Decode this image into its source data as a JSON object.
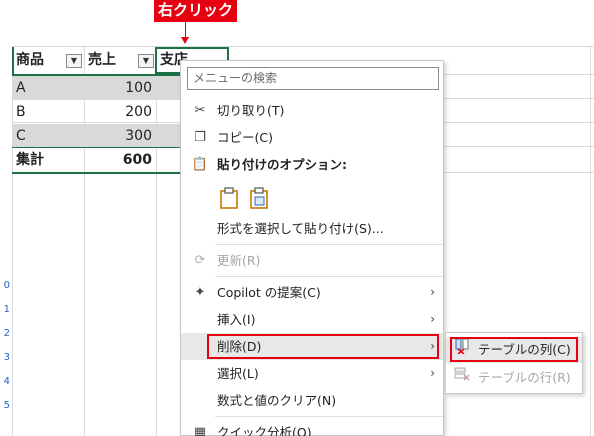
{
  "callout": {
    "text": "右クリック"
  },
  "table": {
    "headers": [
      "商品",
      "売上",
      "支店"
    ],
    "rows": [
      {
        "item": "A",
        "sales": "100"
      },
      {
        "item": "B",
        "sales": "200"
      },
      {
        "item": "C",
        "sales": "300"
      }
    ],
    "total": {
      "label": "集計",
      "value": "600"
    }
  },
  "row_numbers": [
    "0",
    "1",
    "2",
    "3",
    "4",
    "5"
  ],
  "context_menu": {
    "search_placeholder": "メニューの検索",
    "items": {
      "cut": "切り取り(T)",
      "copy": "コピー(C)",
      "paste_options": "貼り付けのオプション:",
      "paste_special": "形式を選択して貼り付け(S)...",
      "refresh": "更新(R)",
      "copilot": "Copilot の提案(C)",
      "insert": "挿入(I)",
      "delete": "削除(D)",
      "select": "選択(L)",
      "clear": "数式と値のクリア(N)",
      "quick_analysis": "クイック分析(Q)"
    }
  },
  "submenu": {
    "table_columns": "テーブルの列(C)",
    "table_rows": "テーブルの行(R)"
  },
  "colors": {
    "accent_red": "#e60012",
    "table_border": "#1e7145",
    "band": "#d9d9d9"
  }
}
